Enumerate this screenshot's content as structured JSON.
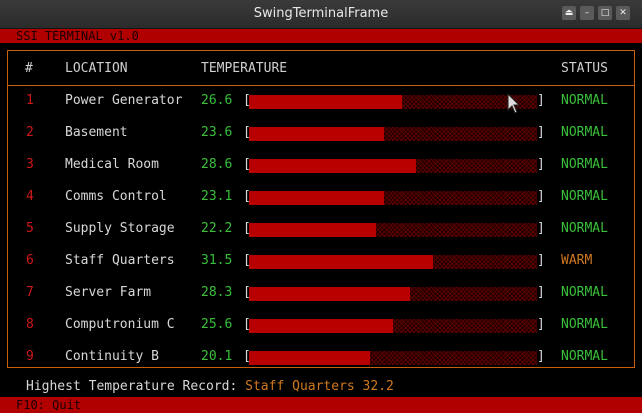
{
  "window": {
    "title": "SwingTerminalFrame"
  },
  "app": {
    "header": "SSI TERMINAL v1.0",
    "footer_hint": "F10: Quit"
  },
  "table": {
    "columns": {
      "num": "#",
      "location": "LOCATION",
      "temperature": "TEMPERATURE",
      "status": "STATUS"
    },
    "rows": [
      {
        "num": "1",
        "location": "Power Generator",
        "temp": "26.6",
        "level": 0.53,
        "status": "NORMAL"
      },
      {
        "num": "2",
        "location": "Basement",
        "temp": "23.6",
        "level": 0.47,
        "status": "NORMAL"
      },
      {
        "num": "3",
        "location": "Medical Room",
        "temp": "28.6",
        "level": 0.58,
        "status": "NORMAL"
      },
      {
        "num": "4",
        "location": "Comms Control",
        "temp": "23.1",
        "level": 0.47,
        "status": "NORMAL"
      },
      {
        "num": "5",
        "location": "Supply Storage",
        "temp": "22.2",
        "level": 0.44,
        "status": "NORMAL"
      },
      {
        "num": "6",
        "location": "Staff Quarters",
        "temp": "31.5",
        "level": 0.64,
        "status": "WARM"
      },
      {
        "num": "7",
        "location": "Server Farm",
        "temp": "28.3",
        "level": 0.56,
        "status": "NORMAL"
      },
      {
        "num": "8",
        "location": "Computronium C",
        "temp": "25.6",
        "level": 0.5,
        "status": "NORMAL"
      },
      {
        "num": "9",
        "location": "Continuity B",
        "temp": "20.1",
        "level": 0.42,
        "status": "NORMAL"
      }
    ]
  },
  "record": {
    "label": "Highest Temperature Record:",
    "value": "Staff Quarters 32.2"
  },
  "colors": {
    "normal": "#38c038",
    "warm": "#d07820",
    "bar": "#b80000",
    "accent": "#b00000"
  }
}
